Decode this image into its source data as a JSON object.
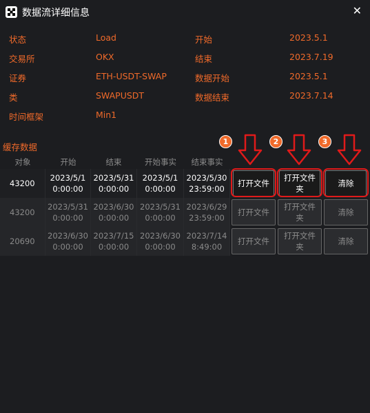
{
  "window": {
    "title": "数据流详细信息",
    "icon": "app-logo-icon",
    "close_icon": "✕"
  },
  "info": [
    {
      "label1": "状态",
      "value1": "Load",
      "label2": "开始",
      "value2": "2023.5.1"
    },
    {
      "label1": "交易所",
      "value1": "OKX",
      "label2": "结束",
      "value2": "2023.7.19"
    },
    {
      "label1": "证券",
      "value1": "ETH-USDT-SWAP",
      "label2": "数据开始",
      "value2": "2023.5.1"
    },
    {
      "label1": "类",
      "value1": "SWAPUSDT",
      "label2": "数据结束",
      "value2": "2023.7.14"
    },
    {
      "label1": "时间框架",
      "value1": "Min1",
      "label2": "",
      "value2": ""
    }
  ],
  "cache": {
    "title": "缓存数据",
    "columns": [
      "对象",
      "开始",
      "结束",
      "开始事实",
      "结束事实"
    ],
    "rows": [
      {
        "obj": "43200",
        "start": "2023/5/1\n0:00:00",
        "end": "2023/5/31\n0:00:00",
        "start_fact": "2023/5/1\n0:00:00",
        "end_fact": "2023/5/30\n23:59:00",
        "active": true
      },
      {
        "obj": "43200",
        "start": "2023/5/31\n0:00:00",
        "end": "2023/6/30\n0:00:00",
        "start_fact": "2023/5/31\n0:00:00",
        "end_fact": "2023/6/29\n23:59:00",
        "active": false
      },
      {
        "obj": "20690",
        "start": "2023/6/30\n0:00:00",
        "end": "2023/7/15\n0:00:00",
        "start_fact": "2023/6/30\n0:00:00",
        "end_fact": "2023/7/14\n8:49:00",
        "active": false
      }
    ],
    "buttons": {
      "open_file": "打开文件",
      "open_folder": "打开文件夹",
      "clear": "清除"
    }
  },
  "annotations": {
    "badges": [
      "1",
      "2",
      "3"
    ],
    "highlight_color": "#e01a1a",
    "badge_color": "#f06a2a"
  }
}
